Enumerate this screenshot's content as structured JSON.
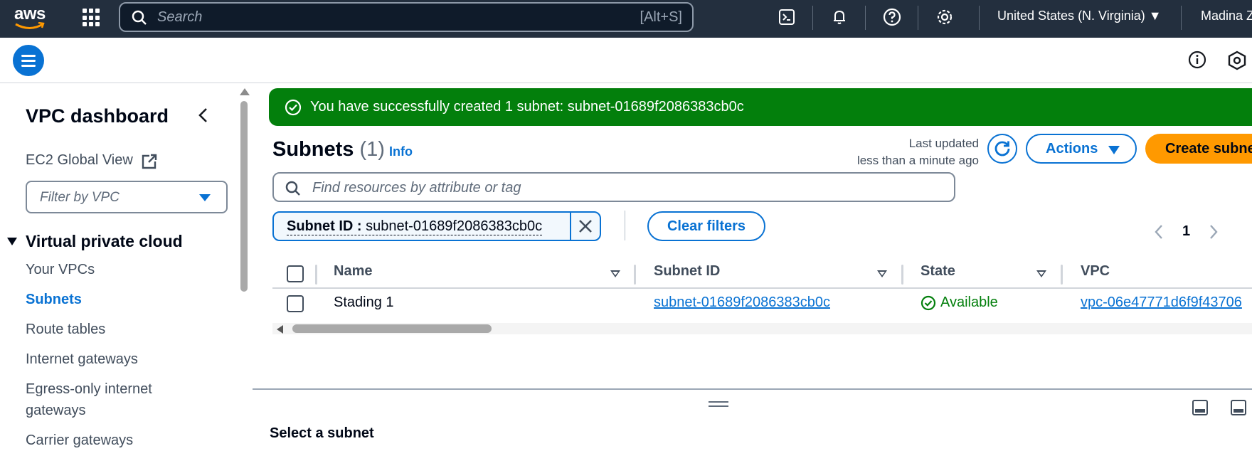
{
  "topnav": {
    "logo_text": "aws",
    "search_placeholder": "Search",
    "search_shortcut": "[Alt+S]",
    "region": "United States (N. Virginia) ▼",
    "user": "Madina Z",
    "icons": [
      "cloudshell-icon",
      "bell-icon",
      "help-icon",
      "settings-icon"
    ]
  },
  "sidebar": {
    "title": "VPC dashboard",
    "ec2_global_view": "EC2 Global View",
    "filter_placeholder": "Filter by VPC",
    "section": "Virtual private cloud",
    "items": [
      {
        "label": "Your VPCs",
        "active": false
      },
      {
        "label": "Subnets",
        "active": true
      },
      {
        "label": "Route tables",
        "active": false
      },
      {
        "label": "Internet gateways",
        "active": false
      },
      {
        "label": "Egress-only internet gateways",
        "active": false
      },
      {
        "label": "Carrier gateways",
        "active": false
      }
    ]
  },
  "flash": {
    "message": "You have successfully created 1 subnet: subnet-01689f2086383cb0c",
    "color": "#037f0c"
  },
  "main": {
    "title": "Subnets",
    "count": "(1)",
    "info": "Info",
    "last_updated_line1": "Last updated",
    "last_updated_line2": "less than a minute ago",
    "actions_label": "Actions",
    "create_label": "Create subnet",
    "search_placeholder": "Find resources by attribute or tag",
    "filter_token_key": "Subnet ID :",
    "filter_token_value": "subnet-01689f2086383cb0c",
    "clear_filters": "Clear filters",
    "page_number": "1"
  },
  "table": {
    "columns": [
      "Name",
      "Subnet ID",
      "State",
      "VPC"
    ],
    "rows": [
      {
        "name": "Stading 1",
        "subnet_id": "subnet-01689f2086383cb0c",
        "state": "Available",
        "vpc": "vpc-06e47771d6f9f43706"
      }
    ]
  },
  "bottom_panel": {
    "title": "Select a subnet"
  },
  "colors": {
    "nav_bg": "#232f3e",
    "link": "#0972d3",
    "primary": "#ff9900",
    "success": "#037f0c"
  }
}
